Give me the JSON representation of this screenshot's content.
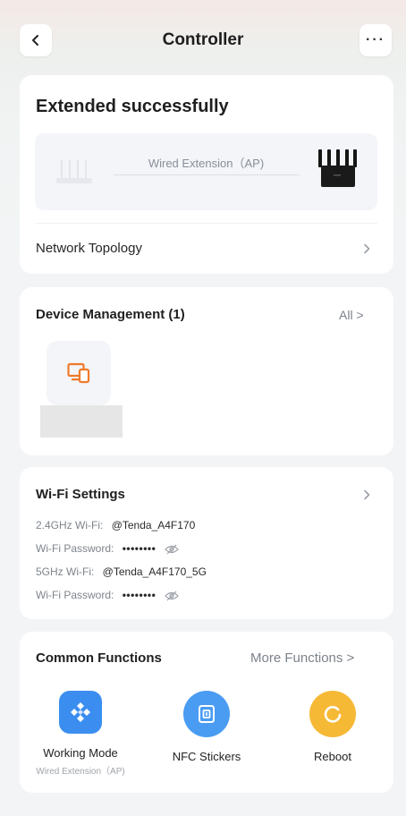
{
  "header": {
    "title": "Controller",
    "more_label": "···"
  },
  "status": {
    "title": "Extended successfully",
    "extension_mode": "Wired Extension（AP)"
  },
  "topology": {
    "label": "Network Topology"
  },
  "devices": {
    "title": "Device Management (1)",
    "all_label": "All >"
  },
  "wifi": {
    "title": "Wi-Fi Settings",
    "ssid_24_label": "2.4GHz Wi-Fi:",
    "ssid_24_value": "@Tenda_A4F170",
    "password_label": "Wi-Fi Password:",
    "password_mask": "••••••••",
    "ssid_5_label": "5GHz Wi-Fi:",
    "ssid_5_value": "@Tenda_A4F170_5G"
  },
  "common": {
    "title": "Common Functions",
    "more_label": "More Functions >",
    "items": [
      {
        "label": "Working Mode",
        "sublabel": "Wired Extension（AP)"
      },
      {
        "label": "NFC Stickers"
      },
      {
        "label": "Reboot"
      }
    ]
  },
  "colors": {
    "device_icon": "#f07a2c",
    "working_mode_icon": "#3b8ef0",
    "nfc_icon": "#4a9cf2",
    "reboot_icon": "#f6b936"
  }
}
